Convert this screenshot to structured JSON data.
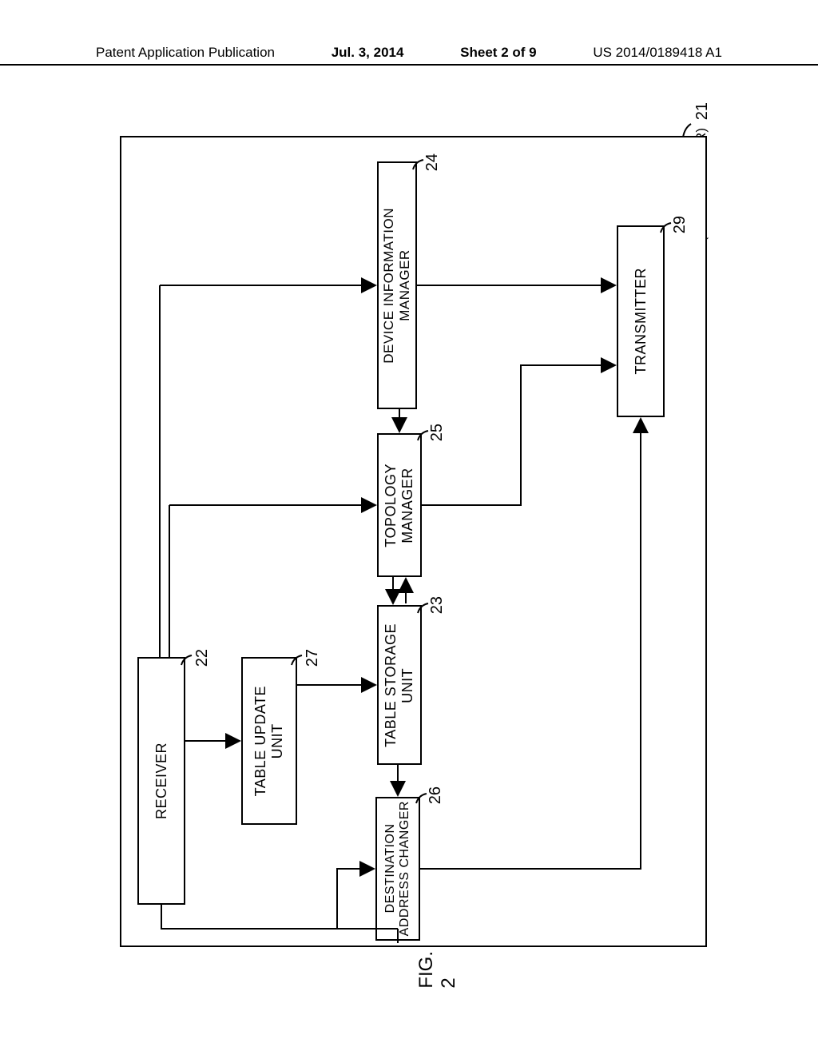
{
  "header": {
    "left": "Patent Application Publication",
    "date": "Jul. 3, 2014",
    "sheet": "Sheet 2 of 9",
    "pubno": "US 2014/0189418 A1"
  },
  "diagram": {
    "container_ref": "21",
    "container_label": "(SAS EXPANDER)",
    "blocks": {
      "receiver": {
        "ref": "22",
        "label": "RECEIVER"
      },
      "table_update": {
        "ref": "27",
        "label": "TABLE UPDATE\nUNIT"
      },
      "device_info": {
        "ref": "24",
        "label": "DEVICE INFORMATION\nMANAGER"
      },
      "topology": {
        "ref": "25",
        "label": "TOPOLOGY\nMANAGER"
      },
      "table_storage": {
        "ref": "23",
        "label": "TABLE STORAGE\nUNIT"
      },
      "dest_addr": {
        "ref": "26",
        "label": "DESTINATION\nADDRESS CHANGER"
      },
      "transmitter": {
        "ref": "29",
        "label": "TRANSMITTER"
      }
    },
    "caption": "FIG. 2"
  }
}
